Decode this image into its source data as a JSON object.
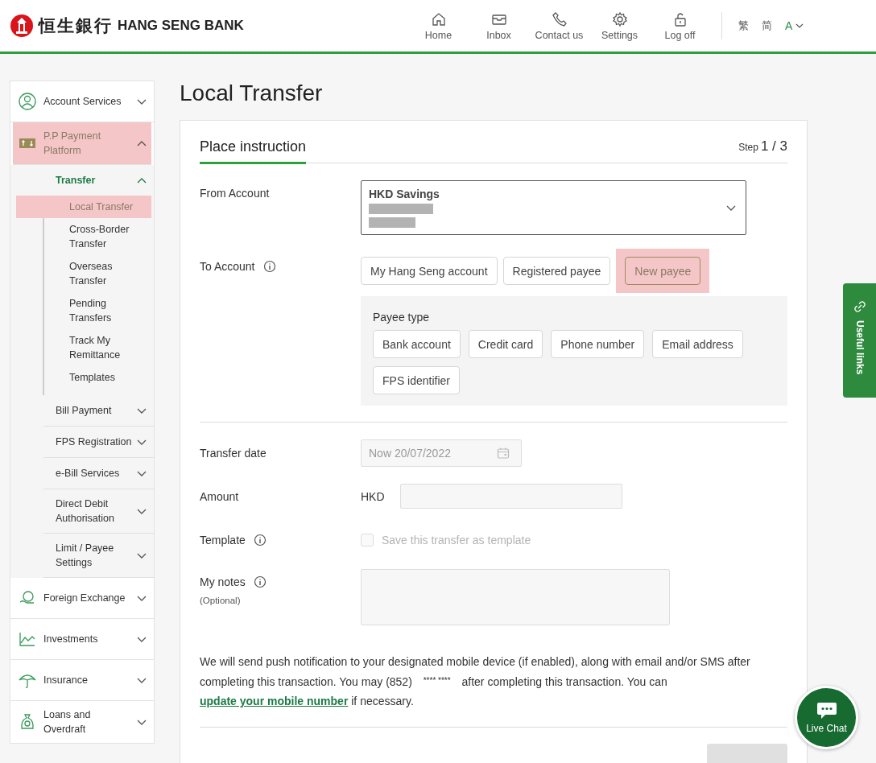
{
  "header": {
    "logo_chinese": "恒生銀行",
    "logo_text": "HANG SENG BANK",
    "nav": [
      {
        "label": "Home",
        "kind": "home"
      },
      {
        "label": "Inbox",
        "kind": "inbox"
      },
      {
        "label": "Contact us",
        "kind": "phone"
      },
      {
        "label": "Settings",
        "kind": "gear"
      },
      {
        "label": "Log off",
        "kind": "lock"
      }
    ],
    "languages": [
      "繁",
      "简"
    ],
    "font_size": "A"
  },
  "sidebar": {
    "items": [
      {
        "label": "Account Services",
        "kind": "person",
        "expanded": false,
        "highlighted": false
      },
      {
        "label": "P.P Payment Platform",
        "kind": "money",
        "expanded": true,
        "highlighted": true,
        "children": [
          {
            "label": "Transfer",
            "expanded": true,
            "active": true,
            "children": [
              {
                "label": "Local Transfer",
                "highlighted": true
              },
              {
                "label": "Cross-Border Transfer",
                "highlighted": false
              },
              {
                "label": "Overseas Transfer",
                "highlighted": false
              },
              {
                "label": "Pending Transfers",
                "highlighted": false
              },
              {
                "label": "Track My Remittance",
                "highlighted": false
              },
              {
                "label": "Templates",
                "highlighted": false
              }
            ]
          },
          {
            "label": "Bill Payment",
            "expanded": false,
            "active": false
          },
          {
            "label": "FPS Registration",
            "expanded": false,
            "active": false
          },
          {
            "label": "e-Bill Services",
            "expanded": false,
            "active": false
          },
          {
            "label": "Direct Debit Authorisation",
            "expanded": false,
            "active": false
          },
          {
            "label": "Limit / Payee Settings",
            "expanded": false,
            "active": false
          }
        ]
      },
      {
        "label": "Foreign Exchange",
        "kind": "fx",
        "expanded": false,
        "highlighted": false
      },
      {
        "label": "Investments",
        "kind": "chart",
        "expanded": false,
        "highlighted": false
      },
      {
        "label": "Insurance",
        "kind": "umbrella",
        "expanded": false,
        "highlighted": false
      },
      {
        "label": "Loans and Overdraft",
        "kind": "bag",
        "expanded": false,
        "highlighted": false
      }
    ]
  },
  "page_title": "Local Transfer",
  "card": {
    "tab": "Place instruction",
    "step_label": "Step",
    "step": "1 / 3",
    "from_account": {
      "label": "From Account",
      "account_name": "HKD Savings"
    },
    "to_account": {
      "label": "To Account",
      "options": [
        {
          "label": "My Hang Seng account",
          "selected": false,
          "highlighted": false
        },
        {
          "label": "Registered payee",
          "selected": false,
          "highlighted": false
        },
        {
          "label": "New payee",
          "selected": true,
          "highlighted": true
        }
      ],
      "payee_type": {
        "label": "Payee type",
        "options": [
          "Bank account",
          "Credit card",
          "Phone number",
          "Email address",
          "FPS identifier"
        ]
      }
    },
    "transfer_date": {
      "label": "Transfer date",
      "placeholder": "Now 20/07/2022",
      "disabled": true
    },
    "amount": {
      "label": "Amount",
      "currency": "HKD"
    },
    "template": {
      "label": "Template",
      "checkbox_label": "Save this transfer as template",
      "checked": false,
      "disabled": true
    },
    "notes": {
      "label": "My notes",
      "hint": "(Optional)"
    },
    "notice": {
      "text_1": "We will send push notification to your designated mobile device (if enabled), along with email and/or SMS after completing this transaction. You may (852)",
      "masked_number": "**** ****",
      "text_2": "after completing this transaction. You can",
      "link": "update your mobile number",
      "text_3": "if necessary."
    }
  },
  "useful_links": "Useful links",
  "live_chat": "Live Chat"
}
